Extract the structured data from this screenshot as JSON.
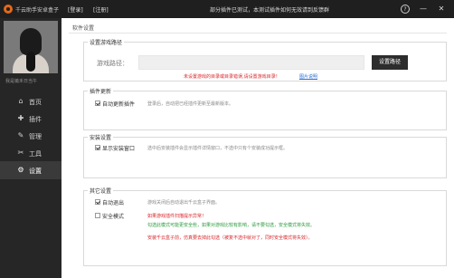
{
  "titlebar": {
    "app_name": "千云助手安卓盒子",
    "login_label": "[登录]",
    "register_label": "[注册]",
    "notice": "部分插件已测试，本测试插件如何无效请到反馈群",
    "help_glyph": "?",
    "minimize_glyph": "—",
    "close_glyph": "✕"
  },
  "sidebar": {
    "username": "我是锄禾日当午",
    "items": [
      {
        "label": "首页",
        "icon": "home-icon",
        "glyph": "⌂"
      },
      {
        "label": "插件",
        "icon": "cube-icon",
        "glyph": "✚"
      },
      {
        "label": "管理",
        "icon": "wrench-icon",
        "glyph": "✎"
      },
      {
        "label": "工具",
        "icon": "tools-icon",
        "glyph": "✂"
      },
      {
        "label": "设置",
        "icon": "gear-icon",
        "glyph": "⚙"
      }
    ],
    "active_index": 4
  },
  "main": {
    "page_title": "软件设置",
    "game_path": {
      "title": "设置游戏路径",
      "label": "游戏路径：",
      "value": "",
      "button_label": "设置路径",
      "warning": "未设置游戏的目录或目录错误,请设置游戏目录！",
      "link_label": "图片说明"
    },
    "plugin_update": {
      "title": "插件更新",
      "checkbox_label": "自动更新插件",
      "checked": true,
      "desc": "登录后，自动把已经插件更新至最新版本。"
    },
    "install_settings": {
      "title": "安装设置",
      "checkbox_label": "显示安装窗口",
      "checked": true,
      "desc": "选中后安装插件会显示插件详情窗口，不选中只有个安装成功提示框。"
    },
    "other_settings": {
      "title": "其它设置",
      "auto_exit": {
        "label": "自动退出",
        "checked": true,
        "desc": "游戏关闭后自动退出千云盒子界面。"
      },
      "safe_mode": {
        "label": "安全模式",
        "checked": false,
        "line1": "如果游戏插件扫描提示异常！",
        "line2": "勾选此模式可能更安全些，如果对游戏比较有影响，请不要勾选，安全模式将失效。",
        "line3": "安装千云盒子前，仿真要去掉此勾选（被复不选中就对了，同时安全模式将失效）。"
      }
    }
  },
  "colors": {
    "titlebar": "#1f1f1f",
    "sidebar": "#262626",
    "active_item": "#3a3a3a",
    "warning_red": "#d9252a",
    "info_green": "#2a9a3a",
    "link_blue": "#2a6fd6"
  }
}
